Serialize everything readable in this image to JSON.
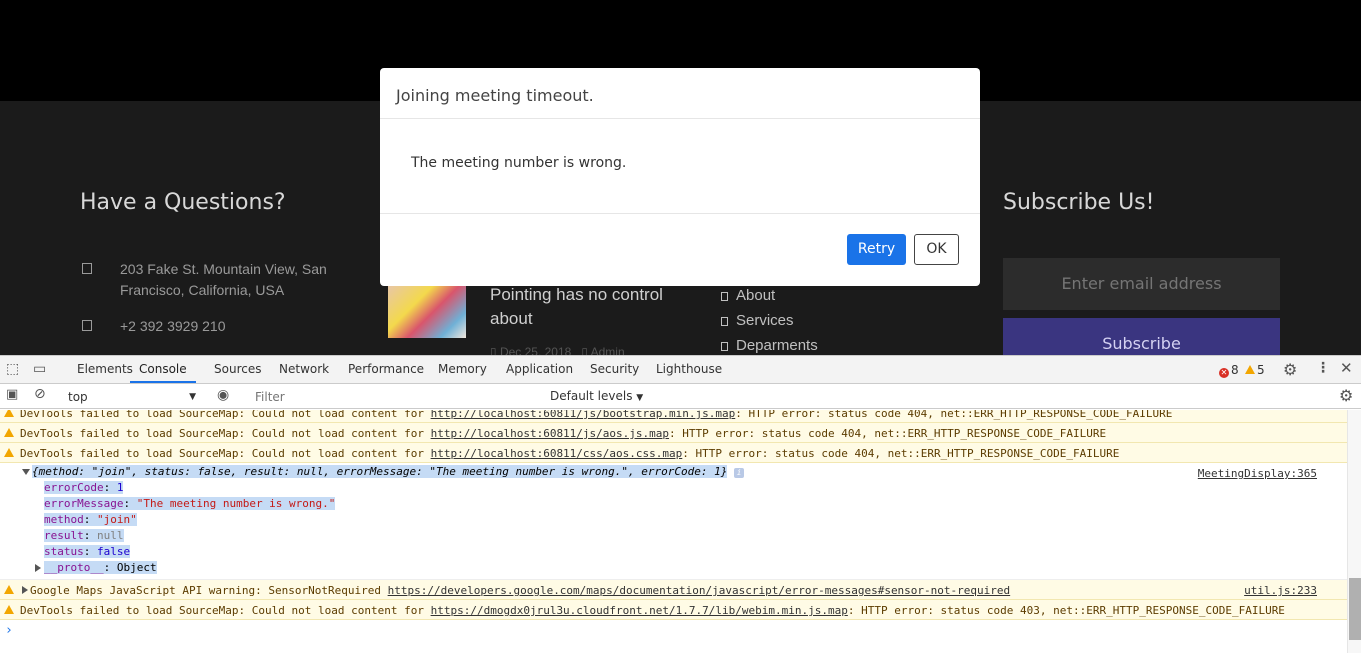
{
  "site": {
    "contact_heading": "Have a Questions?",
    "address": "203 Fake St. Mountain View, San Francisco, California, USA",
    "phone": "+2 392 3929 210",
    "blog_title": "Pointing has no control about",
    "blog_date": "Dec 25, 2018",
    "blog_author": "Admin",
    "nav_links": [
      "About",
      "Services",
      "Deparments"
    ],
    "subscribe_heading": "Subscribe Us!",
    "email_placeholder": "Enter email address",
    "subscribe_button": "Subscribe"
  },
  "modal": {
    "title": "Joining meeting timeout.",
    "body": "The meeting number is wrong.",
    "retry_label": "Retry",
    "ok_label": "OK"
  },
  "devtools": {
    "tabs": [
      "Elements",
      "Console",
      "Sources",
      "Network",
      "Performance",
      "Memory",
      "Application",
      "Security",
      "Lighthouse"
    ],
    "active_tab": "Console",
    "error_count": "8",
    "warning_count": "5",
    "context": "top",
    "filter_placeholder": "Filter",
    "levels_label": "Default levels",
    "messages": {
      "m0": {
        "prefix": "DevTools failed to load SourceMap: Could not load content for ",
        "url": "http://localhost:60811/js/bootstrap.min.js.map",
        "suffix": ": HTTP error: status code 404, net::ERR_HTTP_RESPONSE_CODE_FAILURE"
      },
      "m1": {
        "prefix": "DevTools failed to load SourceMap: Could not load content for ",
        "url": "http://localhost:60811/js/aos.js.map",
        "suffix": ": HTTP error: status code 404, net::ERR_HTTP_RESPONSE_CODE_FAILURE"
      },
      "m2": {
        "prefix": "DevTools failed to load SourceMap: Could not load content for ",
        "url": "http://localhost:60811/css/aos.css.map",
        "suffix": ": HTTP error: status code 404, net::ERR_HTTP_RESPONSE_CODE_FAILURE"
      },
      "object": {
        "summary": "{method: \"join\", status: false, result: null, errorMessage: \"The meeting number is wrong.\", errorCode: 1}",
        "source": "MeetingDisplay:365",
        "props": {
          "errorCode_key": "errorCode",
          "errorCode_val": "1",
          "errorMessage_key": "errorMessage",
          "errorMessage_val": "\"The meeting number is wrong.\"",
          "method_key": "method",
          "method_val": "\"join\"",
          "result_key": "result",
          "result_val": "null",
          "status_key": "status",
          "status_val": "false",
          "proto_key": "__proto__",
          "proto_val": "Object"
        }
      },
      "m4": {
        "prefix": "Google Maps JavaScript API warning: SensorNotRequired ",
        "url": "https://developers.google.com/maps/documentation/javascript/error-messages#sensor-not-required",
        "source": "util.js:233"
      },
      "m5": {
        "prefix": "DevTools failed to load SourceMap: Could not load content for ",
        "url": "https://dmogdx0jrul3u.cloudfront.net/1.7.7/lib/webim.min.js.map",
        "suffix": ": HTTP error: status code 403, net::ERR_HTTP_RESPONSE_CODE_FAILURE"
      }
    }
  }
}
